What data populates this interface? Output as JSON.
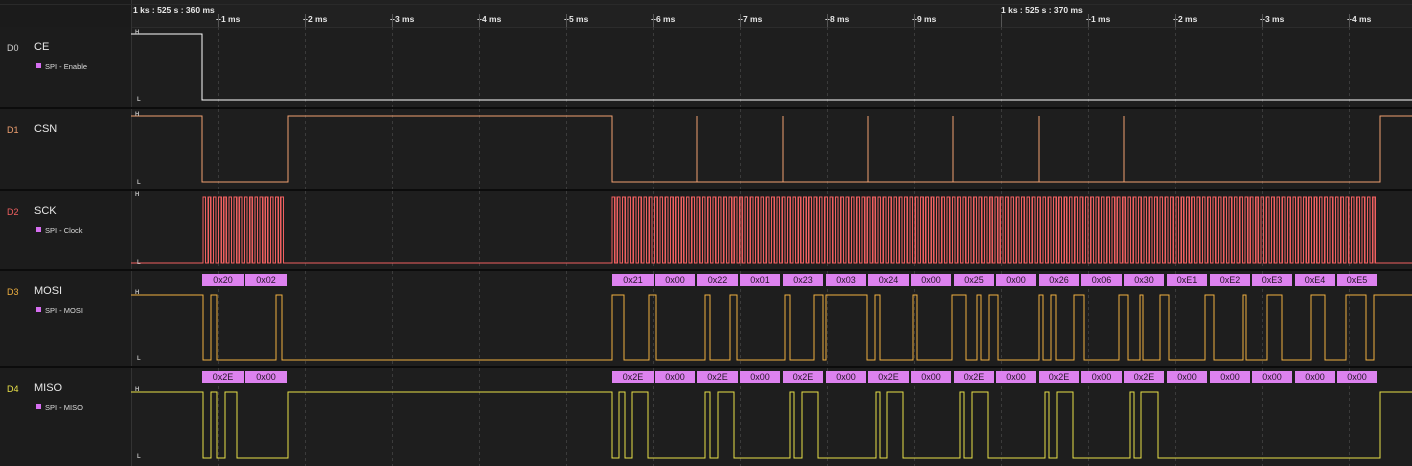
{
  "timeline": {
    "start_label": "1 ks : 525 s : 360 ms",
    "marker_label": "1 ks : 525 s : 370 ms",
    "ticks": [
      "+1 ms",
      "+2 ms",
      "+3 ms",
      "+4 ms",
      "+5 ms",
      "+6 ms",
      "+7 ms",
      "+8 ms",
      "+9 ms",
      "+1 ms",
      "+2 ms",
      "+3 ms",
      "+4 ms"
    ]
  },
  "levels": {
    "high": "H",
    "low": "L"
  },
  "channels": [
    {
      "index": "D0",
      "name": "CE",
      "color": "#ffffff",
      "analyzer": "SPI - Enable"
    },
    {
      "index": "D1",
      "name": "CSN",
      "color": "#f0a070",
      "analyzer": ""
    },
    {
      "index": "D2",
      "name": "SCK",
      "color": "#f06060",
      "analyzer": "SPI - Clock"
    },
    {
      "index": "D3",
      "name": "MOSI",
      "color": "#f0b040",
      "analyzer": "SPI - MOSI"
    },
    {
      "index": "D4",
      "name": "MISO",
      "color": "#e8e048",
      "analyzer": "SPI - MISO"
    }
  ],
  "decoded": {
    "accent": "#dd82ef",
    "mosi": [
      "0x20",
      "0x02",
      "0x21",
      "0x00",
      "0x22",
      "0x01",
      "0x23",
      "0x03",
      "0x24",
      "0x00",
      "0x25",
      "0x00",
      "0x26",
      "0x06",
      "0x30",
      "0xE1",
      "0xE2",
      "0xE3",
      "0xE4",
      "0xE5"
    ],
    "miso": [
      "0x2E",
      "0x00",
      "0x2E",
      "0x00",
      "0x2E",
      "0x00",
      "0x2E",
      "0x00",
      "0x2E",
      "0x00",
      "0x2E",
      "0x00",
      "0x2E",
      "0x00",
      "0x2E",
      "0x00",
      "0x00",
      "0x00",
      "0x00",
      "0x00"
    ]
  }
}
